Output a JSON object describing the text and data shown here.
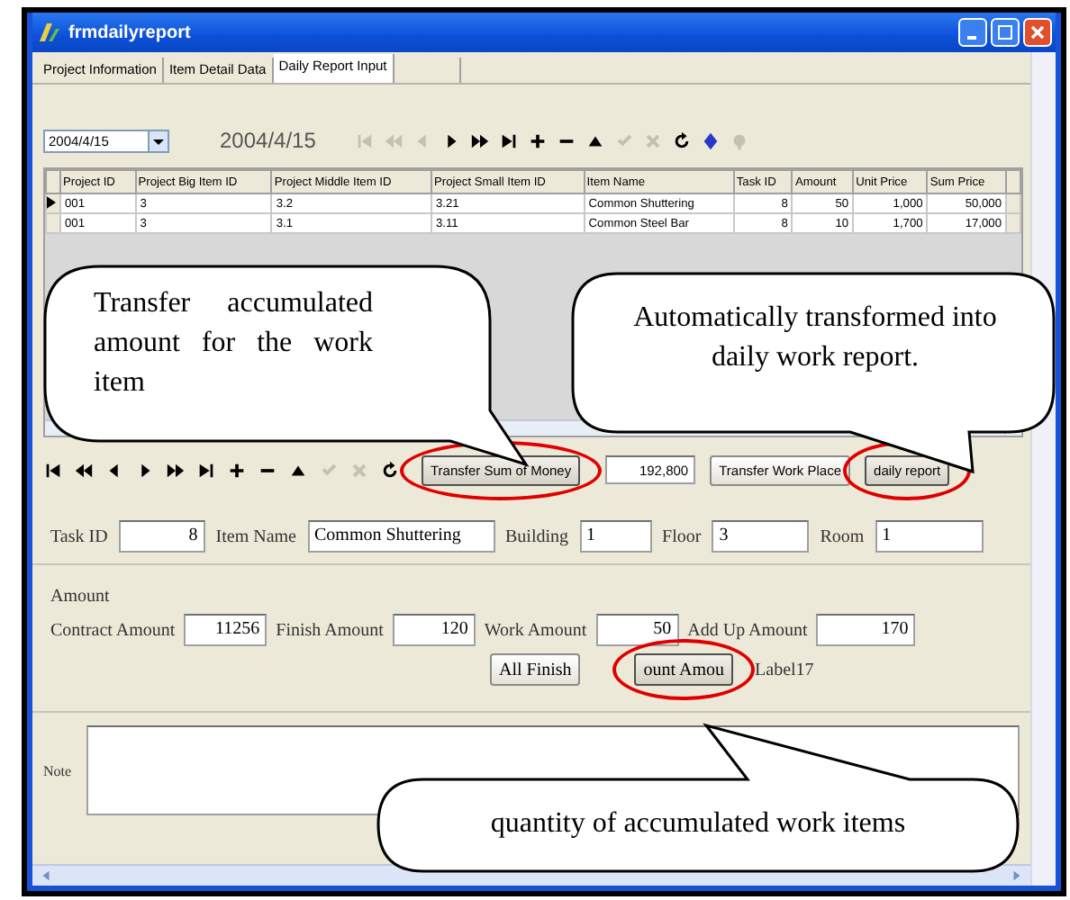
{
  "window": {
    "title": "frmdailyreport"
  },
  "tabs": [
    {
      "label": "Project Information",
      "selected": false
    },
    {
      "label": "Item Detail Data",
      "selected": false
    },
    {
      "label": "Daily Report Input",
      "selected": true
    }
  ],
  "toolbar": {
    "date_combo": {
      "value": "2004/4/15"
    },
    "date_label": "2004/4/15",
    "buttons": [
      {
        "kind": "first",
        "disabled": true
      },
      {
        "kind": "prev_page",
        "disabled": true
      },
      {
        "kind": "prev",
        "disabled": true
      },
      {
        "kind": "next",
        "disabled": false
      },
      {
        "kind": "next_page",
        "disabled": false
      },
      {
        "kind": "last",
        "disabled": false
      },
      {
        "kind": "add",
        "disabled": false
      },
      {
        "kind": "delete",
        "disabled": false
      },
      {
        "kind": "up",
        "disabled": false
      },
      {
        "kind": "save",
        "disabled": true
      },
      {
        "kind": "cancel",
        "disabled": true
      },
      {
        "kind": "refresh",
        "disabled": false
      },
      {
        "kind": "edit",
        "disabled": false
      },
      {
        "kind": "find",
        "disabled": true
      }
    ]
  },
  "grid": {
    "columns": [
      {
        "label": "Project ID",
        "numeric": false
      },
      {
        "label": "Project Big Item ID",
        "numeric": false
      },
      {
        "label": "Project Middle Item ID",
        "numeric": false
      },
      {
        "label": "Project Small Item ID",
        "numeric": false
      },
      {
        "label": "Item Name",
        "numeric": false
      },
      {
        "label": "Task ID",
        "numeric": true
      },
      {
        "label": "Amount",
        "numeric": true
      },
      {
        "label": "Unit Price",
        "numeric": true
      },
      {
        "label": "Sum Price",
        "numeric": true
      }
    ],
    "rows": [
      {
        "selected": true,
        "cells": [
          "001",
          "3",
          "3.2",
          "3.21",
          "Common Shuttering",
          "8",
          "50",
          "1,000",
          "50,000"
        ]
      },
      {
        "selected": false,
        "cells": [
          "001",
          "3",
          "3.1",
          "3.11",
          "Common Steel Bar",
          "8",
          "10",
          "1,700",
          "17,000"
        ]
      }
    ]
  },
  "nav_bar": {
    "buttons": [
      {
        "kind": "first",
        "disabled": false
      },
      {
        "kind": "prev_page",
        "disabled": false
      },
      {
        "kind": "prev",
        "disabled": false
      },
      {
        "kind": "next",
        "disabled": false
      },
      {
        "kind": "next_page",
        "disabled": false
      },
      {
        "kind": "last",
        "disabled": false
      },
      {
        "kind": "add",
        "disabled": false
      },
      {
        "kind": "delete",
        "disabled": false
      },
      {
        "kind": "up",
        "disabled": false
      },
      {
        "kind": "save",
        "disabled": true
      },
      {
        "kind": "cancel",
        "disabled": true
      },
      {
        "kind": "refresh",
        "disabled": false
      }
    ],
    "actions": [
      {
        "kind": "button",
        "label": "Transfer Sum of Money",
        "highlighted": true
      },
      {
        "kind": "field",
        "value": "192,800"
      },
      {
        "kind": "button",
        "label": "Transfer Work Place",
        "highlighted": false
      },
      {
        "kind": "button",
        "label": "daily report",
        "highlighted": true
      }
    ]
  },
  "record": {
    "fields": [
      {
        "label": "Task ID",
        "value": "8",
        "numeric": true
      },
      {
        "label": "Item Name",
        "value": "Common Shuttering",
        "numeric": false
      },
      {
        "label": "Building",
        "value": "1",
        "numeric": false
      },
      {
        "label": "Floor",
        "value": "3",
        "numeric": false
      },
      {
        "label": "Room",
        "value": "1",
        "numeric": false
      }
    ]
  },
  "amount": {
    "title": "Amount",
    "fields": [
      {
        "label": "Contract Amount",
        "value": "11256"
      },
      {
        "label": "Finish Amount",
        "value": "120"
      },
      {
        "label": "Work Amount",
        "value": "50"
      },
      {
        "label": "Add Up Amount",
        "value": "170"
      }
    ],
    "buttons": [
      {
        "label": "All Finish",
        "highlighted": false
      },
      {
        "label": "ount Amou",
        "highlighted": true
      }
    ],
    "label": "Label17"
  },
  "note": {
    "label": "Note"
  },
  "callouts": [
    {
      "text": "Transfer accumulated amount for the work item"
    },
    {
      "text": "Automatically transformed into daily work report."
    },
    {
      "text": "quantity of accumulated work items"
    }
  ]
}
